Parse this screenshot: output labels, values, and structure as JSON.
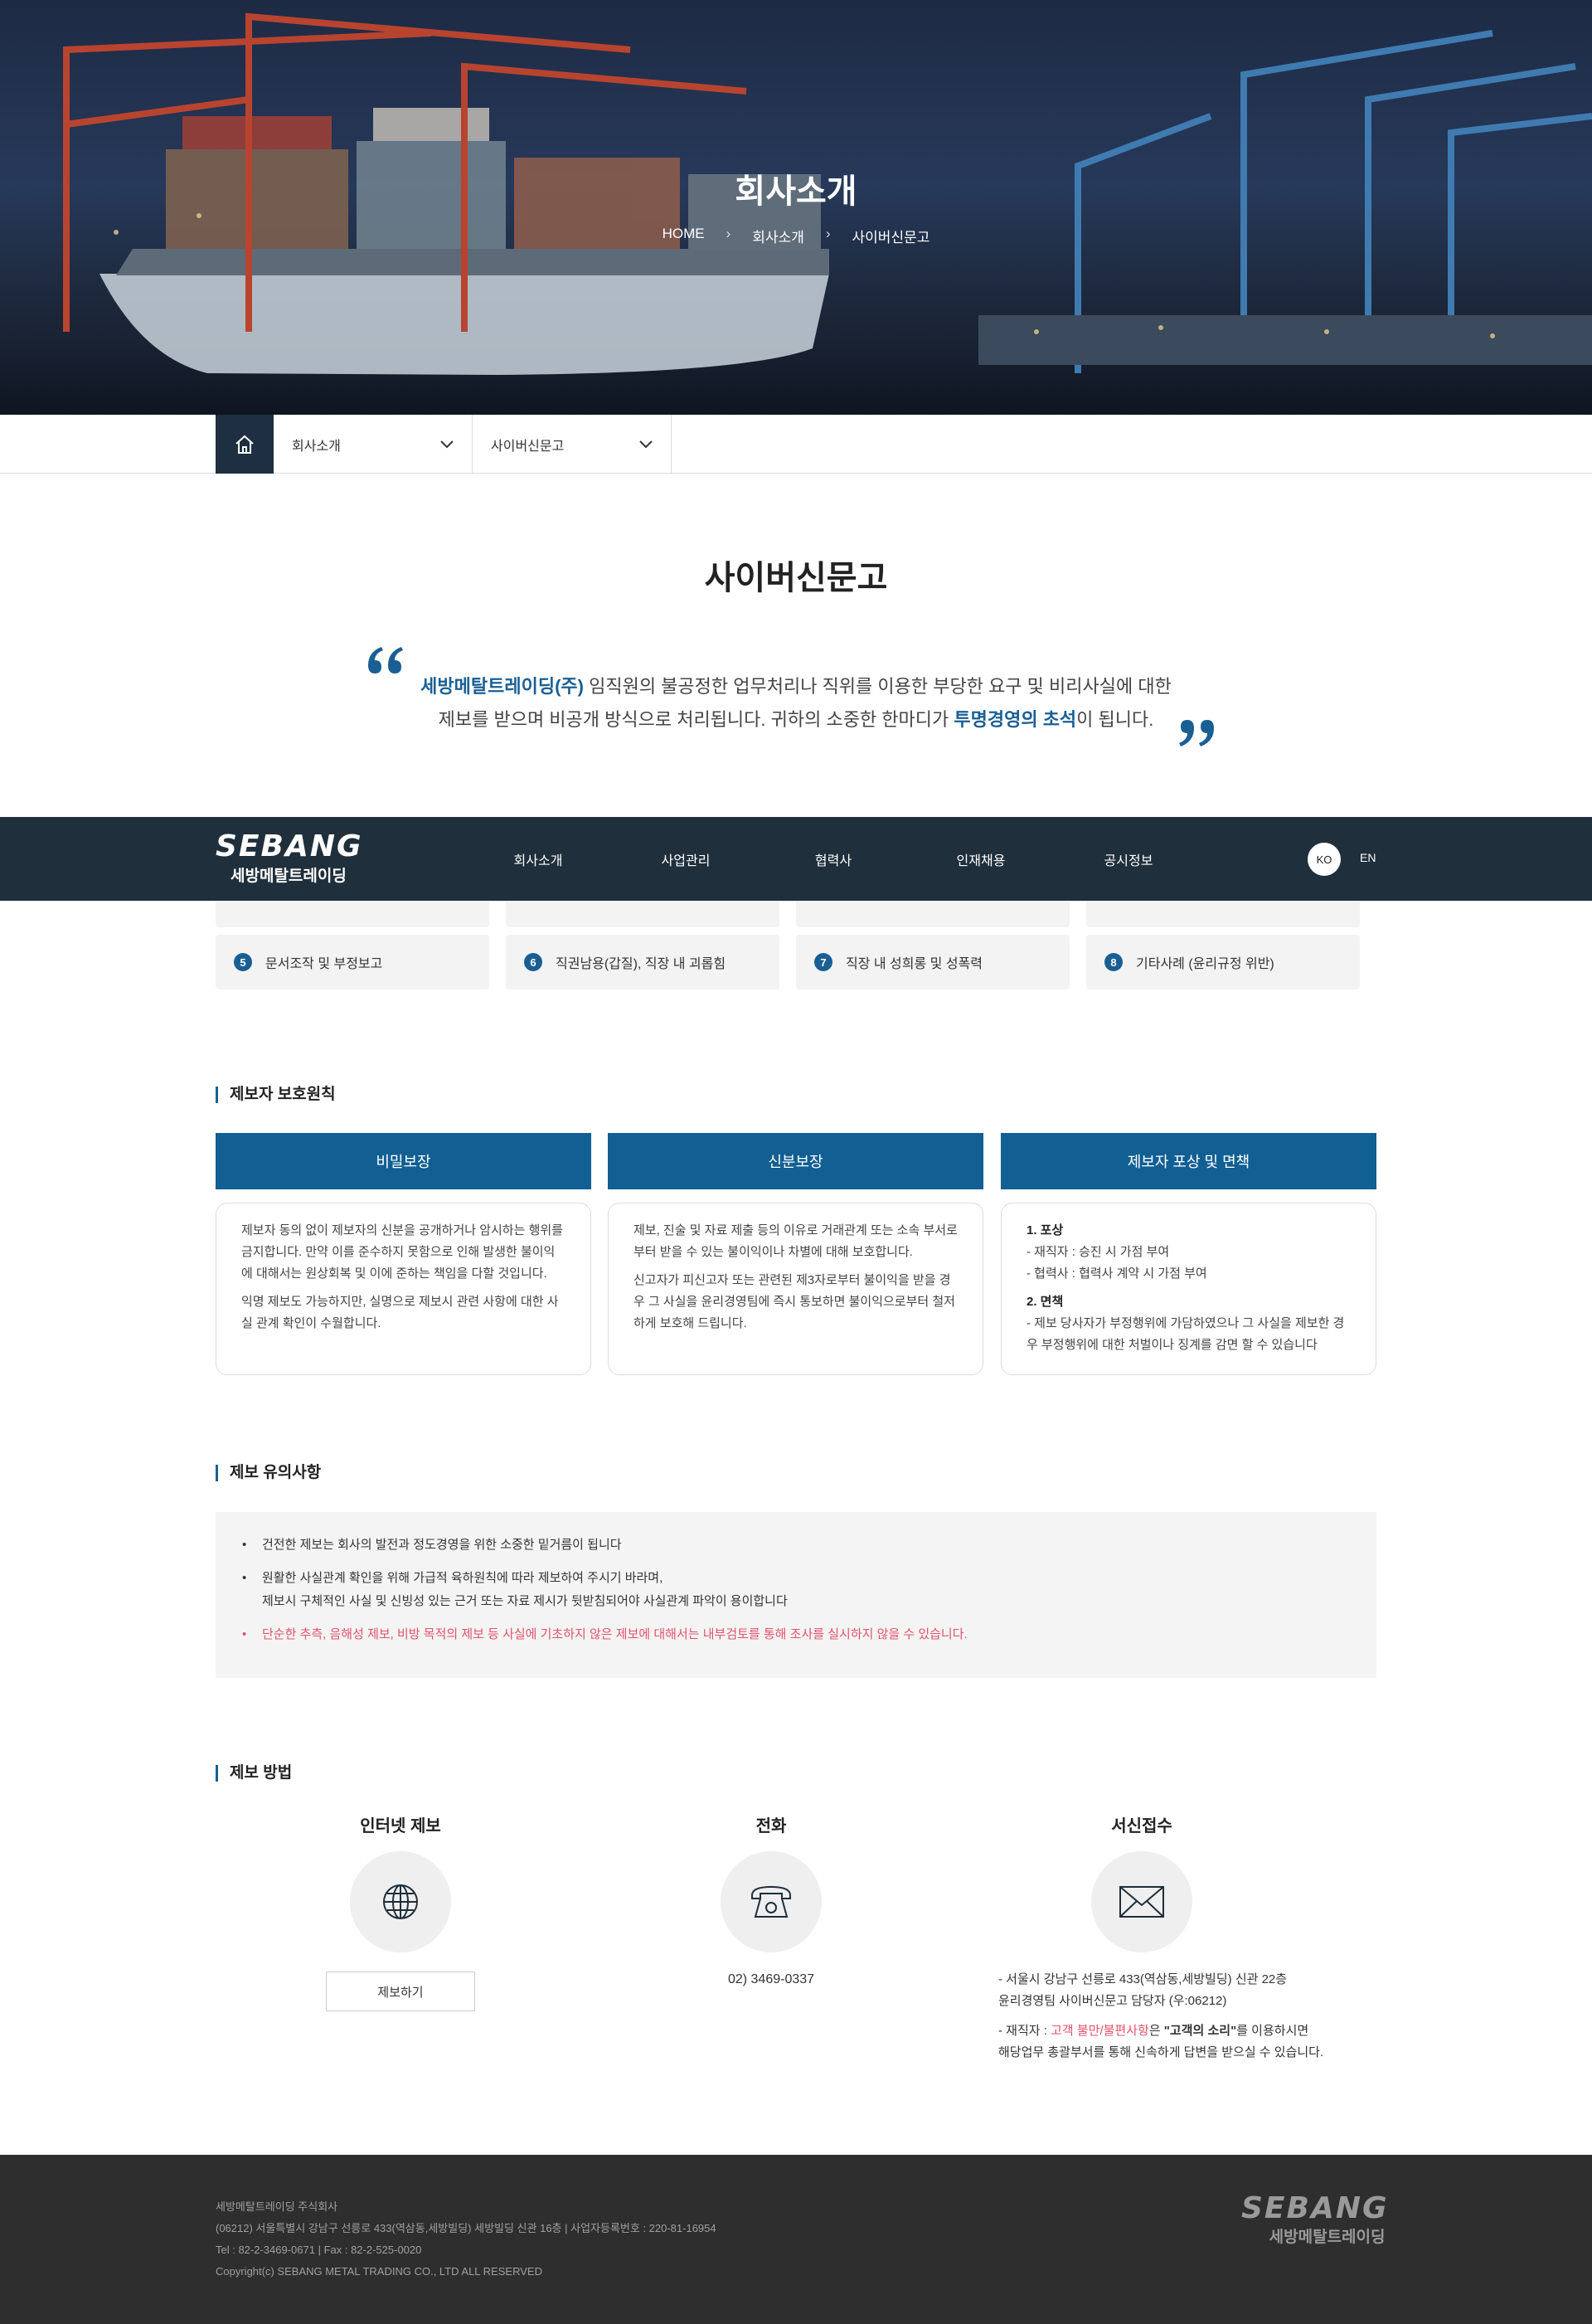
{
  "hero": {
    "title": "회사소개",
    "breadcrumb": [
      "HOME",
      "회사소개",
      "사이버신문고"
    ]
  },
  "subnav": {
    "depth1": "회사소개",
    "depth2": "사이버신문고"
  },
  "page_title": "사이버신문고",
  "intro": {
    "company": "세방메탈트레이딩(주)",
    "line1_rest": " 임직원의 불공정한 업무처리나 직위를 이용한 부당한 요구 및 비리사실에 대한",
    "line2_start": "제보를 받으며 비공개 방식으로 처리됩니다. 귀하의 소중한 한마디가 ",
    "line2_emph": "투명경영의 초석",
    "line2_end": "이 됩니다."
  },
  "header": {
    "logo_en": "SEBANG",
    "logo_ko": "세방메탈트레이딩",
    "menu": [
      "회사소개",
      "사업관리",
      "협력사",
      "인재채용",
      "공시정보"
    ],
    "lang": [
      "KO",
      "EN"
    ]
  },
  "categories": [
    {
      "num": "5",
      "label": "문서조작 및 부정보고"
    },
    {
      "num": "6",
      "label": "직권남용(갑질), 직장 내 괴롭힘"
    },
    {
      "num": "7",
      "label": "직장 내 성희롱 및 성폭력"
    },
    {
      "num": "8",
      "label": "기타사례 (윤리규정 위반)"
    }
  ],
  "protect": {
    "heading": "제보자 보호원칙",
    "columns": [
      {
        "title": "비밀보장",
        "p1": "제보자 동의 없이 제보자의 신분을 공개하거나 암시하는 행위를 금지합니다. 만약 이를 준수하지 못함으로 인해 발생한 불이익에 대해서는 원상회복 및 이에 준하는 책임을 다할 것입니다.",
        "p2": "익명 제보도 가능하지만, 실명으로 제보시 관련 사항에 대한 사실 관계 확인이 수월합니다."
      },
      {
        "title": "신분보장",
        "p1": "제보, 진술 및 자료 제출 등의 이유로 거래관계 또는 소속 부서로부터 받을 수 있는 불이익이나 차별에 대해 보호합니다.",
        "p2": "신고자가 피신고자 또는 관련된 제3자로부터 불이익을 받을 경우 그 사실을 윤리경영팀에 즉시 통보하면 불이익으로부터 철저하게 보호해 드립니다."
      },
      {
        "title": "제보자 포상 및 면책",
        "h1": "1. 포상",
        "l1": "- 재직자 : 승진 시 가점 부여",
        "l2": "- 협력사 : 협력사 계약 시 가점 부여",
        "h2": "2. 면책",
        "l3": "- 제보 당사자가 부정행위에 가담하였으나 그 사실을 제보한 경우 부정행위에 대한 처벌이나 징계를 감면 할 수 있습니다"
      }
    ]
  },
  "notice": {
    "heading": "제보 유의사항",
    "item1": "건전한 제보는 회사의 발전과 정도경영을 위한 소중한 밑거름이 됩니다",
    "item2a": "원활한 사실관계 확인을 위해 가급적 육하원칙에 따라 제보하여 주시기 바라며,",
    "item2b": "제보시 구체적인 사실 및 신빙성 있는 근거 또는 자료 제시가 뒷받침되어야 사실관계 파악이 용이합니다",
    "item3": "단순한 추측, 음해성 제보, 비방 목적의 제보 등 사실에 기초하지 않은 제보에 대해서는 내부검토를 통해 조사를 실시하지 않을 수 있습니다."
  },
  "method": {
    "heading": "제보 방법",
    "internet_title": "인터넷 제보",
    "internet_button": "제보하기",
    "phone_title": "전화",
    "phone_number": "02) 3469-0337",
    "mail_title": "서신접수",
    "mail_addr1": "- 서울시 강남구 선릉로 433(역삼동,세방빌딩) 신관 22층",
    "mail_addr2": "윤리경영팀 사이버신문고 담당자 (우:06212)",
    "mail_note_a": "- 재직자 : ",
    "mail_note_red": "고객 불만/불편사항",
    "mail_note_b": "은 ",
    "mail_note_bold": "\"고객의 소리\"",
    "mail_note_c": "를 이용하시면",
    "mail_note_2": "해당업무 총괄부서를 통해 신속하게 답변을 받으실 수 있습니다."
  },
  "footer": {
    "company": "세방메탈트레이딩 주식회사",
    "address": "(06212) 서울특별시 강남구 선릉로 433(역삼동,세방빌딩) 세방빌딩 신관 16층 | 사업자등록번호 : 220-81-16954",
    "contact": "Tel : 82-2-3469-0671 | Fax : 82-2-525-0020",
    "copyright": "Copyright(c) SEBANG METAL TRADING CO., LTD ALL RESERVED",
    "logo_en": "SEBANG",
    "logo_ko": "세방메탈트레이딩"
  },
  "colors": {
    "accent": "#115f93",
    "header_bg": "#1f2f3b",
    "alert": "#e2526a",
    "footer_bg": "#2e2e2e"
  }
}
